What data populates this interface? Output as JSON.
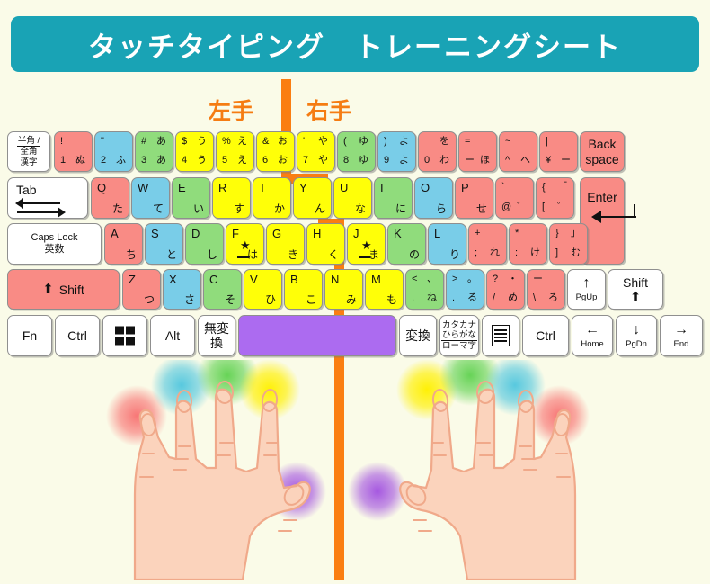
{
  "page": {
    "background_color": "#FAFBE8",
    "accent_color": "#FA7E11",
    "title_bar_color": "#19A3B5"
  },
  "header": {
    "title": "タッチタイピング　トレーニングシート"
  },
  "hand_labels": {
    "left": "左手",
    "right": "右手"
  },
  "legend_colors": {
    "pinky": "#F98B85",
    "ring": "#79CDE8",
    "middle": "#90DC7C",
    "index": "#FFFF08",
    "thumb": "#AC6BF0"
  },
  "keyboard": {
    "row1": [
      {
        "name": "hankaku-zenkaku",
        "color": "white",
        "lines": [
          "半角 /",
          "全角",
          "漢字"
        ]
      },
      {
        "name": "key-1",
        "color": "red",
        "tl": "!",
        "bl": "1",
        "br": "ぬ"
      },
      {
        "name": "key-2",
        "color": "blue",
        "tl": "\"",
        "bl": "2",
        "br": "ふ"
      },
      {
        "name": "key-3",
        "color": "green",
        "tl": "#",
        "tr": "あ",
        "bl": "3",
        "br": "あ"
      },
      {
        "name": "key-4",
        "color": "yellow",
        "tl": "$",
        "tr": "う",
        "bl": "4",
        "br": "う"
      },
      {
        "name": "key-5",
        "color": "yellow",
        "tl": "%",
        "tr": "え",
        "bl": "5",
        "br": "え"
      },
      {
        "name": "key-6",
        "color": "yellow",
        "tl": "&",
        "tr": "お",
        "bl": "6",
        "br": "お"
      },
      {
        "name": "key-7",
        "color": "yellow",
        "tl": "'",
        "tr": "や",
        "bl": "7",
        "br": "や"
      },
      {
        "name": "key-8",
        "color": "green",
        "tl": "(",
        "tr": "ゆ",
        "bl": "8",
        "br": "ゆ"
      },
      {
        "name": "key-9",
        "color": "blue",
        "tl": ")",
        "tr": "よ",
        "bl": "9",
        "br": "よ"
      },
      {
        "name": "key-0",
        "color": "red",
        "tr": "を",
        "bl": "0",
        "br": "わ"
      },
      {
        "name": "key-minus",
        "color": "red",
        "tl": "=",
        "bl": "ー",
        "br": "ほ"
      },
      {
        "name": "key-caret",
        "color": "red",
        "tl": "~",
        "bl": "^",
        "br": "へ"
      },
      {
        "name": "key-yen",
        "color": "red",
        "tl": "|",
        "bl": "¥",
        "br": "ー"
      },
      {
        "name": "backspace",
        "color": "red",
        "lines": [
          "Back",
          "space"
        ]
      }
    ],
    "row2": [
      {
        "name": "tab",
        "color": "white",
        "special": "tab",
        "label": "Tab"
      },
      {
        "name": "key-q",
        "color": "red",
        "letter": "Q",
        "kana": "た"
      },
      {
        "name": "key-w",
        "color": "blue",
        "letter": "W",
        "kana": "て"
      },
      {
        "name": "key-e",
        "color": "green",
        "letter": "E",
        "kana": "い"
      },
      {
        "name": "key-r",
        "color": "yellow",
        "letter": "R",
        "kana": "す"
      },
      {
        "name": "key-t",
        "color": "yellow",
        "letter": "T",
        "kana": "か"
      },
      {
        "name": "key-y",
        "color": "yellow",
        "letter": "Y",
        "kana": "ん"
      },
      {
        "name": "key-u",
        "color": "yellow",
        "letter": "U",
        "kana": "な"
      },
      {
        "name": "key-i",
        "color": "green",
        "letter": "I",
        "kana": "に"
      },
      {
        "name": "key-o",
        "color": "blue",
        "letter": "O",
        "kana": "ら"
      },
      {
        "name": "key-p",
        "color": "red",
        "letter": "P",
        "kana": "せ"
      },
      {
        "name": "key-at",
        "color": "red",
        "tl": "`",
        "bl": "@",
        "br": "゛"
      },
      {
        "name": "key-bracket-left",
        "color": "red",
        "tl": "{",
        "tr": "「",
        "bl": "[",
        "br": "゜"
      },
      {
        "name": "enter",
        "color": "red",
        "special": "enter",
        "label": "Enter"
      }
    ],
    "row3": [
      {
        "name": "caps-lock",
        "color": "white",
        "lines": [
          "Caps Lock",
          "英数"
        ]
      },
      {
        "name": "key-a",
        "color": "red",
        "letter": "A",
        "kana": "ち"
      },
      {
        "name": "key-s",
        "color": "blue",
        "letter": "S",
        "kana": "と"
      },
      {
        "name": "key-d",
        "color": "green",
        "letter": "D",
        "kana": "し"
      },
      {
        "name": "key-f",
        "color": "yellow",
        "letter": "F",
        "kana": "は",
        "home": true
      },
      {
        "name": "key-g",
        "color": "yellow",
        "letter": "G",
        "kana": "き"
      },
      {
        "name": "key-h",
        "color": "yellow",
        "letter": "H",
        "kana": "く"
      },
      {
        "name": "key-j",
        "color": "yellow",
        "letter": "J",
        "kana": "ま",
        "home": true
      },
      {
        "name": "key-k",
        "color": "green",
        "letter": "K",
        "kana": "の"
      },
      {
        "name": "key-l",
        "color": "blue",
        "letter": "L",
        "kana": "り"
      },
      {
        "name": "key-semicolon",
        "color": "red",
        "tl": "+",
        "bl": ";",
        "br": "れ"
      },
      {
        "name": "key-colon",
        "color": "red",
        "tl": "*",
        "bl": ":",
        "br": "け"
      },
      {
        "name": "key-bracket-right",
        "color": "red",
        "tl": "}",
        "tr": "」",
        "bl": "]",
        "br": "む"
      }
    ],
    "row4": [
      {
        "name": "shift-left",
        "color": "red",
        "special": "shift",
        "label": "Shift"
      },
      {
        "name": "key-z",
        "color": "red",
        "letter": "Z",
        "kana": "つ"
      },
      {
        "name": "key-x",
        "color": "blue",
        "letter": "X",
        "kana": "さ"
      },
      {
        "name": "key-c",
        "color": "green",
        "letter": "C",
        "kana": "そ"
      },
      {
        "name": "key-v",
        "color": "yellow",
        "letter": "V",
        "kana": "ひ"
      },
      {
        "name": "key-b",
        "color": "yellow",
        "letter": "B",
        "kana": "こ"
      },
      {
        "name": "key-n",
        "color": "yellow",
        "letter": "N",
        "kana": "み"
      },
      {
        "name": "key-m",
        "color": "yellow",
        "letter": "M",
        "kana": "も"
      },
      {
        "name": "key-comma",
        "color": "green",
        "tl": "<",
        "tr": "、",
        "bl": ",",
        "br": "ね"
      },
      {
        "name": "key-period",
        "color": "blue",
        "tl": ">",
        "tr": "。",
        "bl": ".",
        "br": "る"
      },
      {
        "name": "key-slash",
        "color": "red",
        "tl": "?",
        "tr": "・",
        "bl": "/",
        "br": "め"
      },
      {
        "name": "key-backslash",
        "color": "red",
        "tl": "ー",
        "bl": "\\",
        "br": "ろ"
      },
      {
        "name": "key-up-pgup",
        "color": "white",
        "glyph": "↑",
        "caption": "PgUp"
      },
      {
        "name": "shift-right",
        "color": "white",
        "special": "shift-col",
        "label": "Shift"
      }
    ],
    "row5": [
      {
        "name": "key-fn",
        "color": "white",
        "lines": [
          "Fn"
        ]
      },
      {
        "name": "key-ctrl-left",
        "color": "white",
        "lines": [
          "Ctrl"
        ]
      },
      {
        "name": "key-windows",
        "color": "white",
        "special": "windows"
      },
      {
        "name": "key-alt",
        "color": "white",
        "lines": [
          "Alt"
        ]
      },
      {
        "name": "key-muhenkan",
        "color": "white",
        "lines": [
          "無変換"
        ]
      },
      {
        "name": "key-space",
        "color": "purple"
      },
      {
        "name": "key-henkan",
        "color": "white",
        "lines": [
          "変換"
        ]
      },
      {
        "name": "key-katakana-hiragana",
        "color": "white",
        "lines": [
          "カタカナ",
          "ひらがな",
          "ローマ字"
        ]
      },
      {
        "name": "key-menu",
        "color": "white",
        "special": "menu"
      },
      {
        "name": "key-ctrl-right",
        "color": "white",
        "lines": [
          "Ctrl"
        ]
      },
      {
        "name": "key-left-home",
        "color": "white",
        "glyph": "←",
        "caption": "Home"
      },
      {
        "name": "key-down-pgdn",
        "color": "white",
        "glyph": "↓",
        "caption": "PgDn"
      },
      {
        "name": "key-right-end",
        "color": "white",
        "glyph": "→",
        "caption": "End"
      }
    ]
  },
  "hands": {
    "left": {
      "name": "left-hand-illustration",
      "fingers": [
        {
          "finger": "pinky",
          "color": "#F87070"
        },
        {
          "finger": "ring",
          "color": "#4FC6DE"
        },
        {
          "finger": "middle",
          "color": "#5FD14F"
        },
        {
          "finger": "index",
          "color": "#FFF000"
        },
        {
          "finger": "thumb",
          "color": "#A14FE0"
        }
      ]
    },
    "right": {
      "name": "right-hand-illustration",
      "fingers": [
        {
          "finger": "index",
          "color": "#FFF000"
        },
        {
          "finger": "middle",
          "color": "#5FD14F"
        },
        {
          "finger": "ring",
          "color": "#4FC6DE"
        },
        {
          "finger": "pinky",
          "color": "#F87070"
        },
        {
          "finger": "thumb",
          "color": "#A14FE0"
        }
      ]
    }
  }
}
